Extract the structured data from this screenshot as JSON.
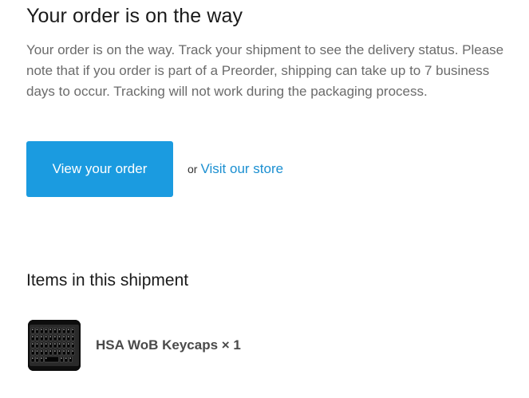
{
  "email": {
    "heading": "Your order is on the way",
    "message": "Your order is on the way. Track your shipment to see the delivery status. Please note that if you order is part of a Preorder, shipping can take up to 7 business days to occur. Tracking will not work during the packaging process.",
    "primary_button": "View your order",
    "or_text": "or",
    "secondary_link": "Visit our store",
    "colors": {
      "button": "#1b9be0",
      "link": "#1b8fd1"
    }
  },
  "shipment": {
    "title": "Items in this shipment",
    "items": [
      {
        "name": "HSA WoB Keycaps × 1",
        "thumbnail": "keyboard-keycaps-image"
      }
    ]
  }
}
